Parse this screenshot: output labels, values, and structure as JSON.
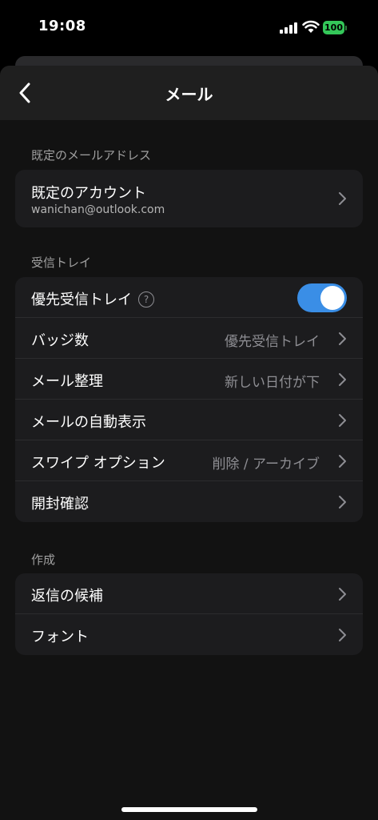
{
  "status_bar": {
    "time": "19:08",
    "battery": "100",
    "battery_color": "#34c759"
  },
  "nav": {
    "back_icon": "chevron-left-icon",
    "title": "メール"
  },
  "sections": {
    "default_address": {
      "header": "既定のメールアドレス",
      "account_label": "既定のアカウント",
      "account_email": "wanichan@outlook.com"
    },
    "inbox": {
      "header": "受信トレイ",
      "focused_inbox_label": "優先受信トレイ",
      "help_glyph": "?",
      "focused_inbox_enabled": true,
      "badge_count_label": "バッジ数",
      "badge_count_value": "優先受信トレイ",
      "organize_label": "メール整理",
      "organize_value": "新しい日付が下",
      "auto_display_label": "メールの自動表示",
      "swipe_label": "スワイプ オプション",
      "swipe_value": "削除 / アーカイブ",
      "read_receipt_label": "開封確認"
    },
    "compose": {
      "header": "作成",
      "reply_suggestions_label": "返信の候補",
      "font_label": "フォント"
    }
  },
  "colors": {
    "toggle_on": "#3a8ee6",
    "background": "#000000",
    "group_bg": "#1c1c1e"
  }
}
